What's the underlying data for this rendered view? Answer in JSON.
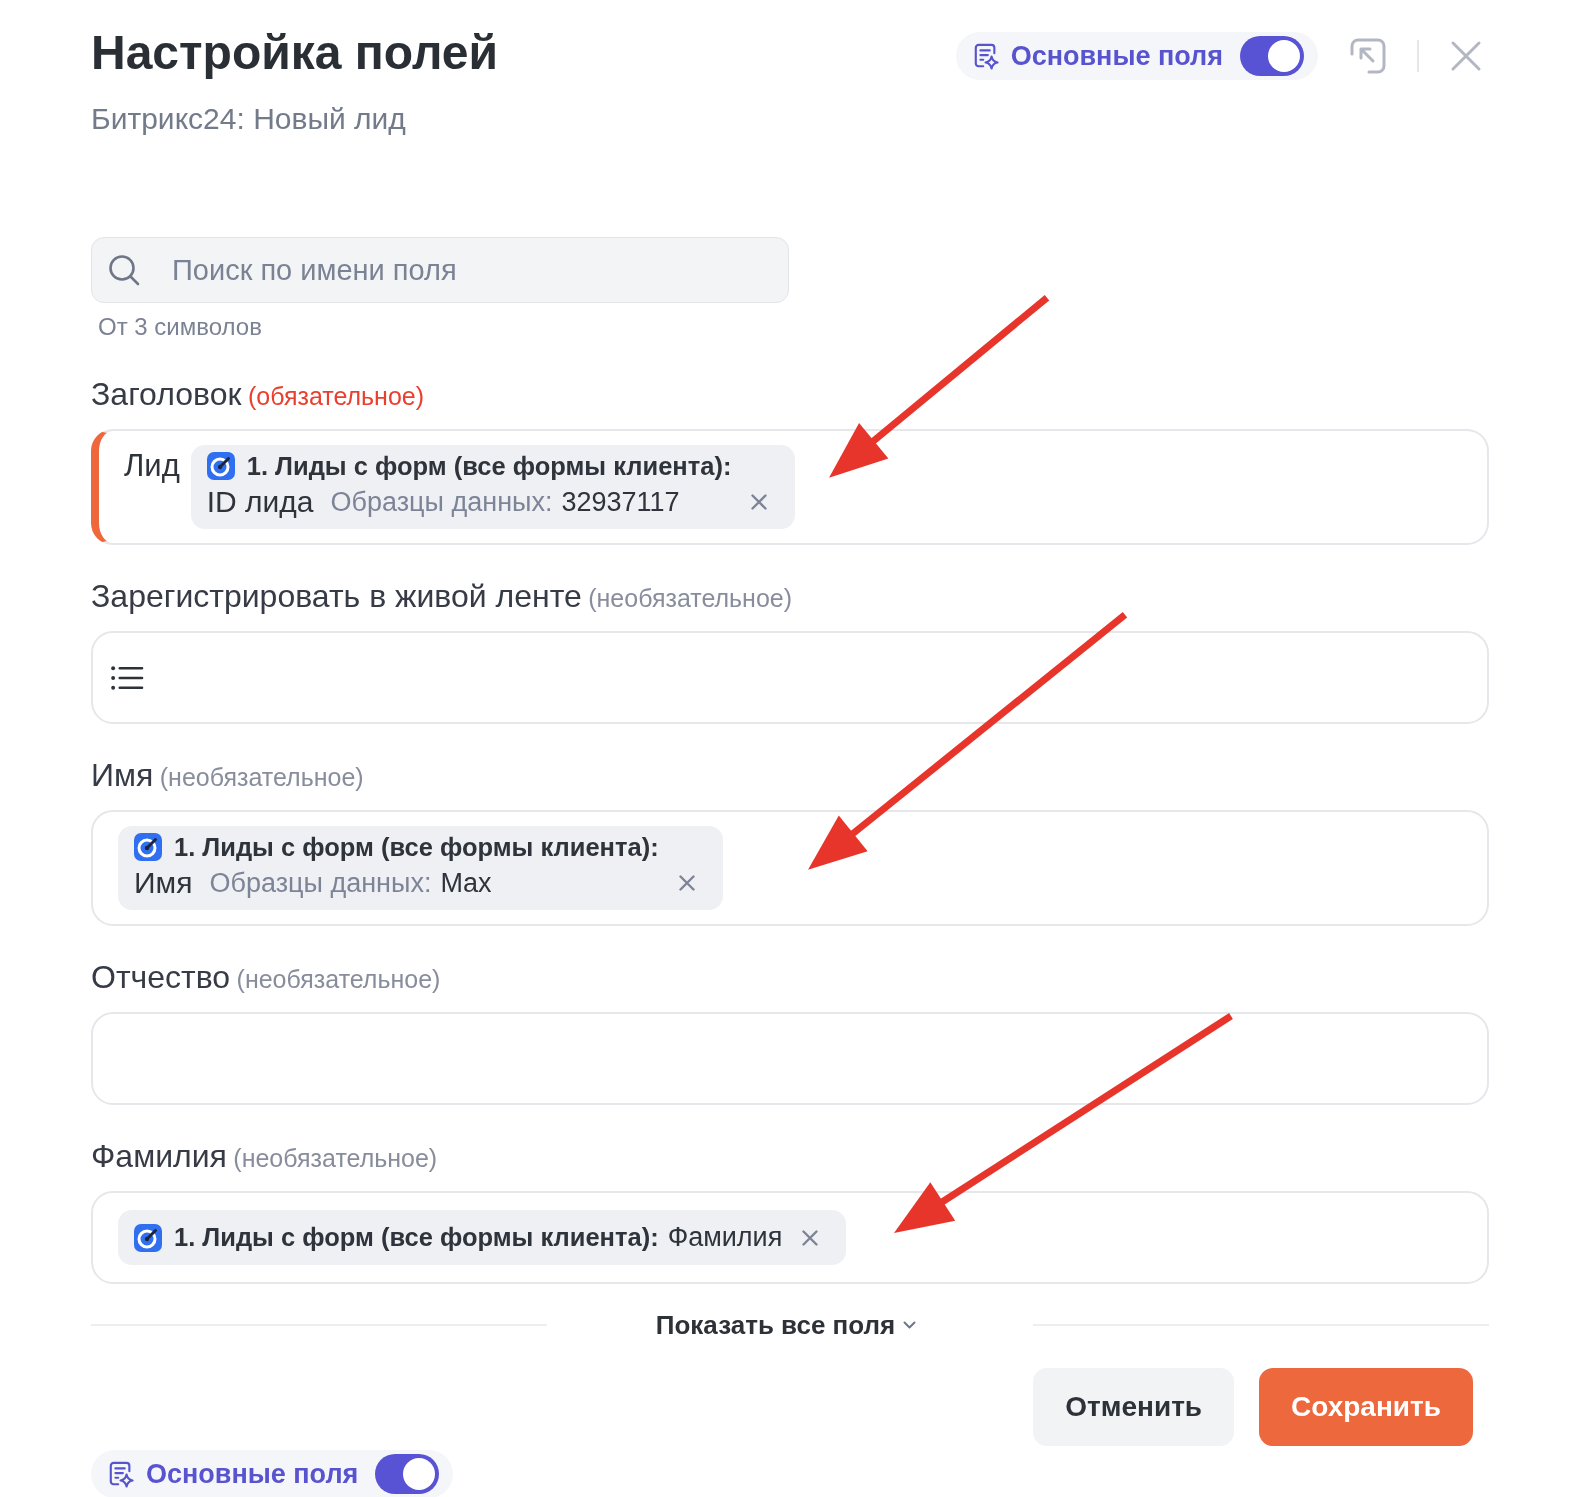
{
  "header": {
    "title": "Настройка полей",
    "subtitle": "Битрикс24: Новый лид",
    "main_fields_toggle": {
      "label": "Основные поля",
      "on": true
    }
  },
  "search": {
    "placeholder": "Поиск по имени поля",
    "hint": "От 3 символов"
  },
  "fields": [
    {
      "label": "Заголовок",
      "qualifier": "(обязательное)",
      "required": true,
      "arrow": true,
      "kind": "mapping",
      "text": "Лид",
      "chips": [
        {
          "source": "1. Лиды с форм (все формы клиента):",
          "field": "ID лида",
          "sample_label": "Образцы данных:",
          "sample_value": "32937117"
        }
      ]
    },
    {
      "label": "Зарегистрировать в живой ленте",
      "qualifier": "(необязательное)",
      "required": false,
      "arrow": false,
      "kind": "list"
    },
    {
      "label": "Имя",
      "qualifier": "(необязательное)",
      "required": false,
      "arrow": true,
      "kind": "mapping",
      "chips": [
        {
          "source": "1. Лиды с форм (все формы клиента):",
          "field": "Имя",
          "sample_label": "Образцы данных:",
          "sample_value": "Max"
        }
      ]
    },
    {
      "label": "Отчество",
      "qualifier": "(необязательное)",
      "required": false,
      "arrow": false,
      "kind": "text"
    },
    {
      "label": "Фамилия",
      "qualifier": "(необязательное)",
      "required": false,
      "arrow": true,
      "kind": "mapping",
      "chips": [
        {
          "source": "1. Лиды с форм (все формы клиента):",
          "field": "Фамилия"
        }
      ]
    }
  ],
  "show_all": {
    "label": "Показать все поля"
  },
  "buttons": [
    {
      "label": "Отменить",
      "kind": "secondary"
    },
    {
      "label": "Сохранить",
      "kind": "primary"
    }
  ],
  "footer_toggle": {
    "label": "Основные поля",
    "on": true
  }
}
